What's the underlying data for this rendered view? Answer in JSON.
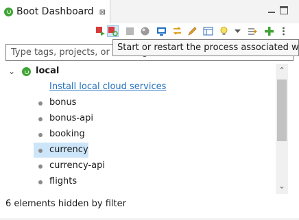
{
  "view": {
    "title": "Boot Dashboard",
    "close_glyph": "⊠",
    "icon": "spring-boot-icon"
  },
  "toolbar": {
    "buttons": [
      {
        "name": "start-button",
        "icon": "run-red-icon"
      },
      {
        "name": "restart-button",
        "icon": "restart-icon",
        "active": true
      },
      {
        "name": "stop-button",
        "icon": "stop-icon"
      },
      {
        "name": "debug-button",
        "icon": "debug-icon"
      },
      {
        "name": "console-button",
        "icon": "console-icon"
      },
      {
        "name": "link-button",
        "icon": "link-icon"
      },
      {
        "name": "edit-button",
        "icon": "pencil-icon"
      },
      {
        "name": "properties-button",
        "icon": "table-icon"
      },
      {
        "name": "hint-button",
        "icon": "lightbulb-icon"
      },
      {
        "name": "dropdown-button",
        "icon": "chevron-down-icon"
      },
      {
        "name": "tags-button",
        "icon": "tags-icon"
      },
      {
        "name": "add-button",
        "icon": "plus-icon"
      },
      {
        "name": "more-button",
        "icon": "more-vertical-icon"
      }
    ]
  },
  "filter": {
    "placeholder": "Type tags, projects, or working set names to match"
  },
  "tooltip": {
    "text": "Start or restart the process associated with the selected elements"
  },
  "tree": {
    "root": {
      "label": "local",
      "expanded": true
    },
    "link_label": "Install local cloud services",
    "items": [
      "bonus",
      "bonus-api",
      "booking",
      "currency",
      "currency-api",
      "flights"
    ],
    "selected": "currency"
  },
  "status": {
    "text": "6 elements hidden by filter"
  },
  "colors": {
    "spring_green": "#3fa535",
    "link_blue": "#1f6fc0",
    "selection": "#cce5f8"
  }
}
